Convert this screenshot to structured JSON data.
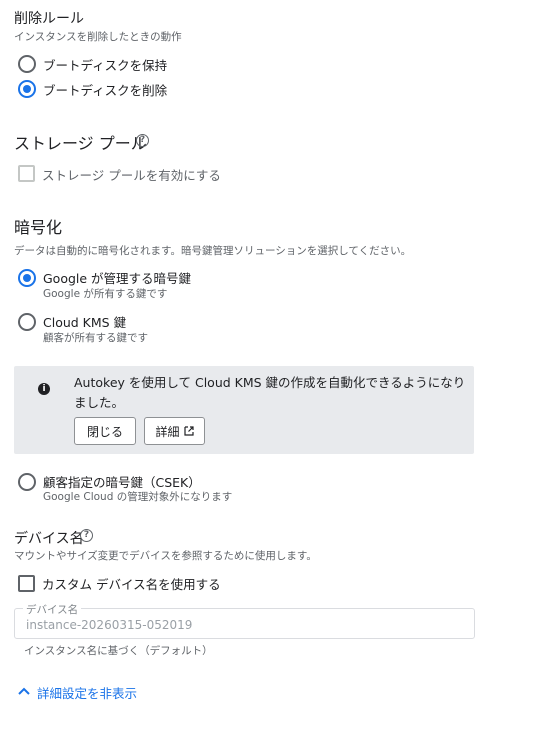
{
  "deletion_rule": {
    "title": "削除ルール",
    "subtitle": "インスタンスを削除したときの動作",
    "options": [
      {
        "label": "ブートディスクを保持",
        "checked": false
      },
      {
        "label": "ブートディスクを削除",
        "checked": true
      }
    ]
  },
  "storage_pool": {
    "title": "ストレージ プール",
    "help_icon": "help-circle-icon",
    "checkbox_label": "ストレージ プールを有効にする",
    "checked": false,
    "disabled": true
  },
  "encryption": {
    "title": "暗号化",
    "subtitle": "データは自動的に暗号化されます。暗号鍵管理ソリューションを選択してください。",
    "options": [
      {
        "label": "Google が管理する暗号鍵",
        "sub": "Google が所有する鍵です",
        "checked": true
      },
      {
        "label": "Cloud KMS 鍵",
        "sub": "顧客が所有する鍵です",
        "checked": false
      },
      {
        "label": "顧客指定の暗号鍵（CSEK）",
        "sub": "Google Cloud の管理対象外になります",
        "checked": false
      }
    ],
    "banner": {
      "icon": "info-icon",
      "text": "Autokey を使用して Cloud KMS 鍵の作成を自動化できるようになりました。",
      "close_label": "閉じる",
      "details_label": "詳細"
    }
  },
  "device_name": {
    "title": "デバイス名",
    "subtitle": "マウントやサイズ変更でデバイスを参照するために使用します。",
    "checkbox_label": "カスタム デバイス名を使用する",
    "checked": false,
    "field_label": "デバイス名",
    "field_value": "instance-20260315-052019",
    "helper": "インスタンス名に基づく（デフォルト）"
  },
  "advanced": {
    "toggle_label": "詳細設定を非表示",
    "icon": "chevron-up-icon"
  },
  "colors": {
    "accent": "#1a73e8",
    "banner_bg": "#e8eaed"
  }
}
